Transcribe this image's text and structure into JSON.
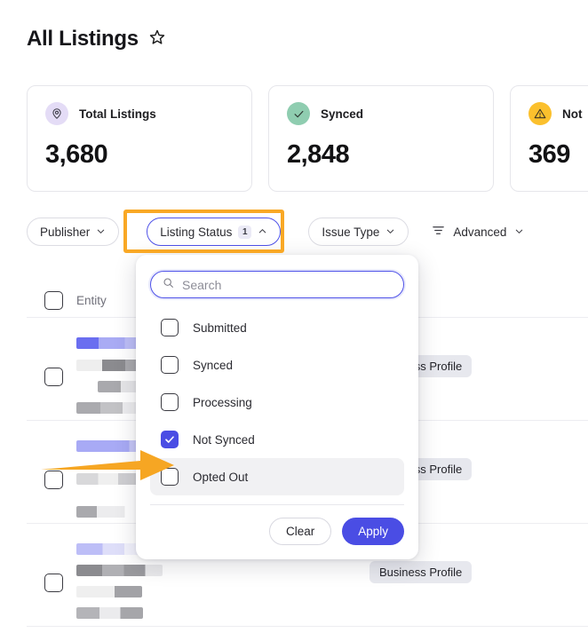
{
  "header": {
    "title": "All Listings",
    "favorite_icon": "star-icon"
  },
  "stats": [
    {
      "label": "Total Listings",
      "value": "3,680",
      "icon": "location-pin-icon",
      "badge_bg": "#e4dcf6",
      "icon_color": "#3b3b45"
    },
    {
      "label": "Synced",
      "value": "2,848",
      "icon": "check-circle-icon",
      "badge_bg": "#8fcdb0",
      "icon_color": "#2f3a33"
    },
    {
      "label": "Not",
      "value": "369",
      "icon": "warning-triangle-icon",
      "badge_bg": "#fbc02d",
      "icon_color": "#3a3325"
    }
  ],
  "filters": {
    "publisher": {
      "label": "Publisher",
      "chevron": "chevron-down-icon"
    },
    "listing_status": {
      "label": "Listing Status",
      "count": "1",
      "chevron": "chevron-up-icon"
    },
    "issue_type": {
      "label": "Issue Type",
      "chevron": "chevron-down-icon"
    },
    "advanced": {
      "label": "Advanced",
      "icon": "filter-lines-icon",
      "chevron": "chevron-down-icon"
    }
  },
  "dropdown": {
    "search": {
      "placeholder": "Search",
      "value": "",
      "icon": "search-icon"
    },
    "options": [
      {
        "label": "Submitted",
        "checked": false,
        "hovered": false
      },
      {
        "label": "Synced",
        "checked": false,
        "hovered": false
      },
      {
        "label": "Processing",
        "checked": false,
        "hovered": false
      },
      {
        "label": "Not Synced",
        "checked": true,
        "hovered": false
      },
      {
        "label": "Opted Out",
        "checked": false,
        "hovered": true
      }
    ],
    "clear_label": "Clear",
    "apply_label": "Apply"
  },
  "table": {
    "columns": {
      "entity": "Entity"
    },
    "rows": [
      {
        "publisher_badge": "Business Profile"
      },
      {
        "publisher_badge": "Business Profile"
      },
      {
        "publisher_badge": "Business Profile"
      }
    ]
  },
  "annotations": {
    "highlight_color": "#f9a825",
    "arrow_color": "#f6a623",
    "accent_color": "#4a4de4"
  }
}
